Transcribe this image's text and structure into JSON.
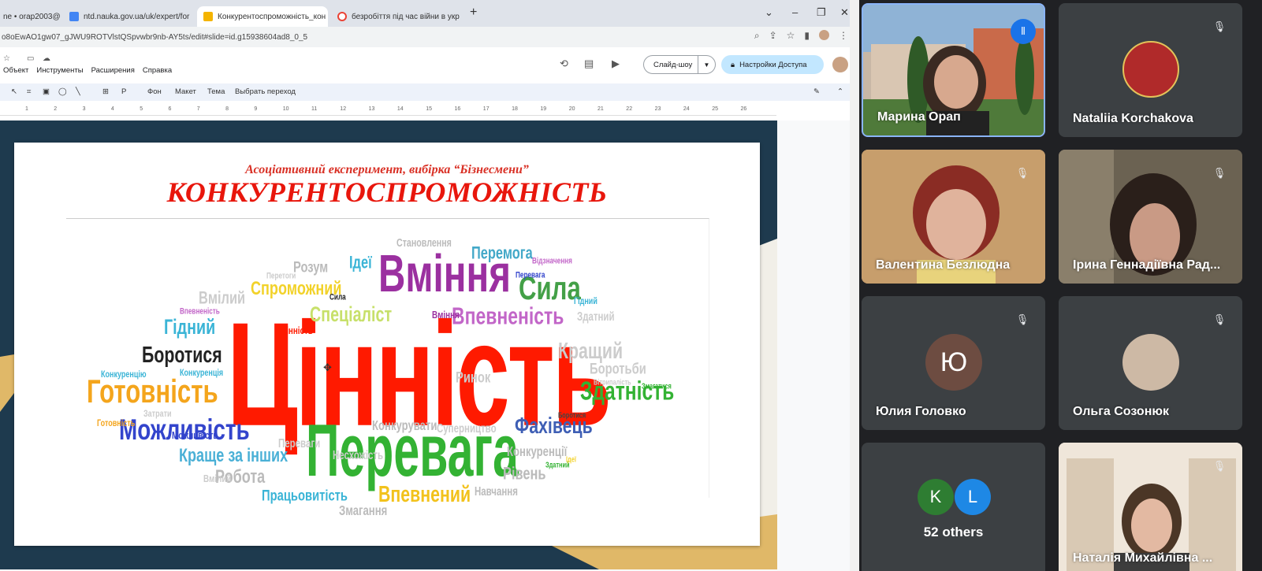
{
  "browser": {
    "tabs": [
      {
        "label": "ne • orap2003@",
        "icon_color": "#d93025"
      },
      {
        "label": "ntd.nauka.gov.ua/uk/expert/for",
        "icon_color": "#4285f4"
      },
      {
        "label": "Конкурентоспроможність_кон",
        "icon_color": "#f4b400"
      },
      {
        "label": "безробіття під час війни в укр",
        "icon_color": "#ea4335"
      }
    ],
    "new_tab": "+",
    "url": "o8oEwAO1gw07_gJWU9ROTVlstQSpvwbr9nb-AY5ts/edit#slide=id.g15938604ad8_0_5"
  },
  "slides_app": {
    "menu": [
      "Объект",
      "Инструменты",
      "Расширения",
      "Справка"
    ],
    "toolbar": {
      "background": "Фон",
      "layout": "Макет",
      "theme": "Тема",
      "transition": "Выбрать переход"
    },
    "slideshow_label": "Слайд-шоу",
    "share_label": "Настройки Доступа",
    "ruler_ticks": [
      "1",
      "2",
      "3",
      "4",
      "5",
      "6",
      "7",
      "8",
      "9",
      "10",
      "11",
      "12",
      "13",
      "14",
      "15",
      "16",
      "17",
      "18",
      "19",
      "20",
      "21",
      "22",
      "23",
      "24",
      "25",
      "26"
    ]
  },
  "slide": {
    "subtitle": "Асоціативний експеримент, вибірка “Бізнесмени”",
    "title": "КОНКУРЕНТОСПРОМОЖНІСТЬ",
    "word_cloud": [
      {
        "text": "Цінність",
        "color": "#ff1a00"
      },
      {
        "text": "Вміння",
        "color": "#9b30a0"
      },
      {
        "text": "Перевага",
        "color": "#33b233"
      },
      {
        "text": "Готовність",
        "color": "#f4a51c"
      },
      {
        "text": "Можливість",
        "color": "#3344cc"
      },
      {
        "text": "Сила",
        "color": "#43a047"
      },
      {
        "text": "Впевненість",
        "color": "#c266c8"
      },
      {
        "text": "Спроможний",
        "color": "#f2d22a"
      },
      {
        "text": "Спеціаліст",
        "color": "#c7e06a"
      },
      {
        "text": "Здатність",
        "color": "#33b233"
      },
      {
        "text": "Фахівець",
        "color": "#3f5fb5"
      },
      {
        "text": "Боротися",
        "color": "#222222"
      },
      {
        "text": "Гідний",
        "color": "#3ab4d6"
      },
      {
        "text": "Перемога",
        "color": "#43a8c8"
      },
      {
        "text": "Ідеї",
        "color": "#3ab4d6"
      },
      {
        "text": "Розум",
        "color": "#bbbbbb"
      },
      {
        "text": "Становлення",
        "color": "#bbbbbb"
      },
      {
        "text": "Кращий",
        "color": "#cccccc"
      },
      {
        "text": "Боротьби",
        "color": "#cccccc"
      },
      {
        "text": "Впевнений",
        "color": "#f2c21c"
      },
      {
        "text": "Робота",
        "color": "#bbbbbb"
      },
      {
        "text": "Працьовитість",
        "color": "#3ab4d6"
      },
      {
        "text": "Краще за інших",
        "color": "#4ab0d6"
      },
      {
        "text": "Конкуренції",
        "color": "#bbbbbb"
      },
      {
        "text": "Рівень",
        "color": "#bbbbbb"
      },
      {
        "text": "Змагання",
        "color": "#bbbbbb"
      },
      {
        "text": "Вмілий",
        "color": "#cccccc"
      },
      {
        "text": "Конкурувати",
        "color": "#bbbbbb"
      },
      {
        "text": "Суперництво",
        "color": "#cccccc"
      },
      {
        "text": "Ринок",
        "color": "#cccccc"
      },
      {
        "text": "Конкуренцію",
        "color": "#3ab4d6"
      },
      {
        "text": "Конкуренція",
        "color": "#3ab4d6"
      },
      {
        "text": "Перетоги",
        "color": "#cccccc"
      },
      {
        "text": "Здатний",
        "color": "#cccccc"
      },
      {
        "text": "Навчання",
        "color": "#bbbbbb"
      },
      {
        "text": "Можливість",
        "color": "#3344cc"
      },
      {
        "text": "Переваги",
        "color": "#cccccc"
      },
      {
        "text": "Відзначення",
        "color": "#c266c8"
      },
      {
        "text": "Перевага",
        "color": "#3344cc"
      },
      {
        "text": "Впевненість",
        "color": "#c266c8"
      },
      {
        "text": "Несхожість",
        "color": "#cccccc"
      },
      {
        "text": "Затрати",
        "color": "#cccccc"
      },
      {
        "text": "Вітрипалість",
        "color": "#cccccc"
      },
      {
        "text": "Змагатися",
        "color": "#33b233"
      },
      {
        "text": "Здатний",
        "color": "#33b233"
      },
      {
        "text": "Боротися",
        "color": "#444444"
      },
      {
        "text": "Цінність",
        "color": "#ff1a00"
      },
      {
        "text": "Вміння",
        "color": "#9b30a0"
      },
      {
        "text": "Сила",
        "color": "#222222"
      },
      {
        "text": "Ідеї",
        "color": "#f2d22a"
      },
      {
        "text": "Готовність",
        "color": "#f4a51c"
      },
      {
        "text": "Гідний",
        "color": "#3ab4d6"
      },
      {
        "text": "Вмілий",
        "color": "#cccccc"
      }
    ]
  },
  "meet": {
    "participants": [
      {
        "name": "Марина Орап",
        "speaking": true
      },
      {
        "name": "Nataliia Korchakova",
        "muted": true
      },
      {
        "name": "Валентина Безлюдна",
        "muted": true
      },
      {
        "name": "Ірина Геннадіївна Рад...",
        "muted": true
      },
      {
        "name": "Юлия Головко",
        "muted": true,
        "initial": "Ю",
        "avatar_color": "#6d4c41"
      },
      {
        "name": "Ольга Созонюк",
        "muted": true
      },
      {
        "others_label": "52 others",
        "avatars": [
          {
            "initial": "K",
            "color": "#2e7d32"
          },
          {
            "initial": "L",
            "color": "#1e88e5"
          }
        ]
      },
      {
        "name": "Наталія Михайлівна ...",
        "muted": true
      }
    ]
  }
}
